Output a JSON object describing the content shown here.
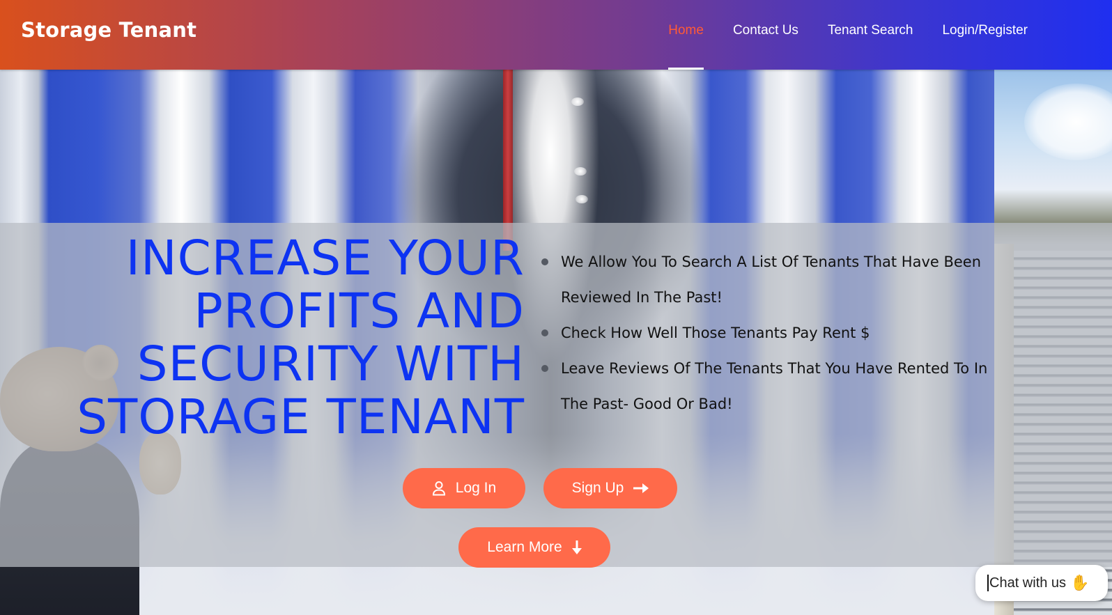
{
  "brand": {
    "title": "Storage Tenant"
  },
  "nav": {
    "items": [
      {
        "label": "Home",
        "active": true
      },
      {
        "label": "Contact Us",
        "active": false
      },
      {
        "label": "Tenant Search",
        "active": false
      },
      {
        "label": "Login/Register",
        "active": false
      }
    ]
  },
  "hero": {
    "headline_lines": [
      "INCREASE YOUR",
      "PROFITS AND",
      "SECURITY WITH",
      "STORAGE TENANT"
    ],
    "features": [
      "We Allow You To Search A List Of Tenants That Have Been Reviewed In The Past!",
      "Check How Well Those Tenants Pay Rent $",
      "Leave Reviews Of The Tenants That You Have Rented To In The Past- Good Or Bad!"
    ],
    "buttons": {
      "login": {
        "label": "Log In",
        "icon": "user-icon"
      },
      "signup": {
        "label": "Sign Up",
        "icon": "arrow-right-icon"
      },
      "learn_more": {
        "label": "Learn More",
        "icon": "arrow-down-icon"
      }
    }
  },
  "chat": {
    "label": "Chat with us",
    "icon": "waving-hand-icon"
  },
  "colors": {
    "accent": "#ff6a4a",
    "nav_active": "#ff5a36",
    "headline": "#0d33f2",
    "nav_gradient_start": "#d9501d",
    "nav_gradient_end": "#1f2ff0"
  }
}
